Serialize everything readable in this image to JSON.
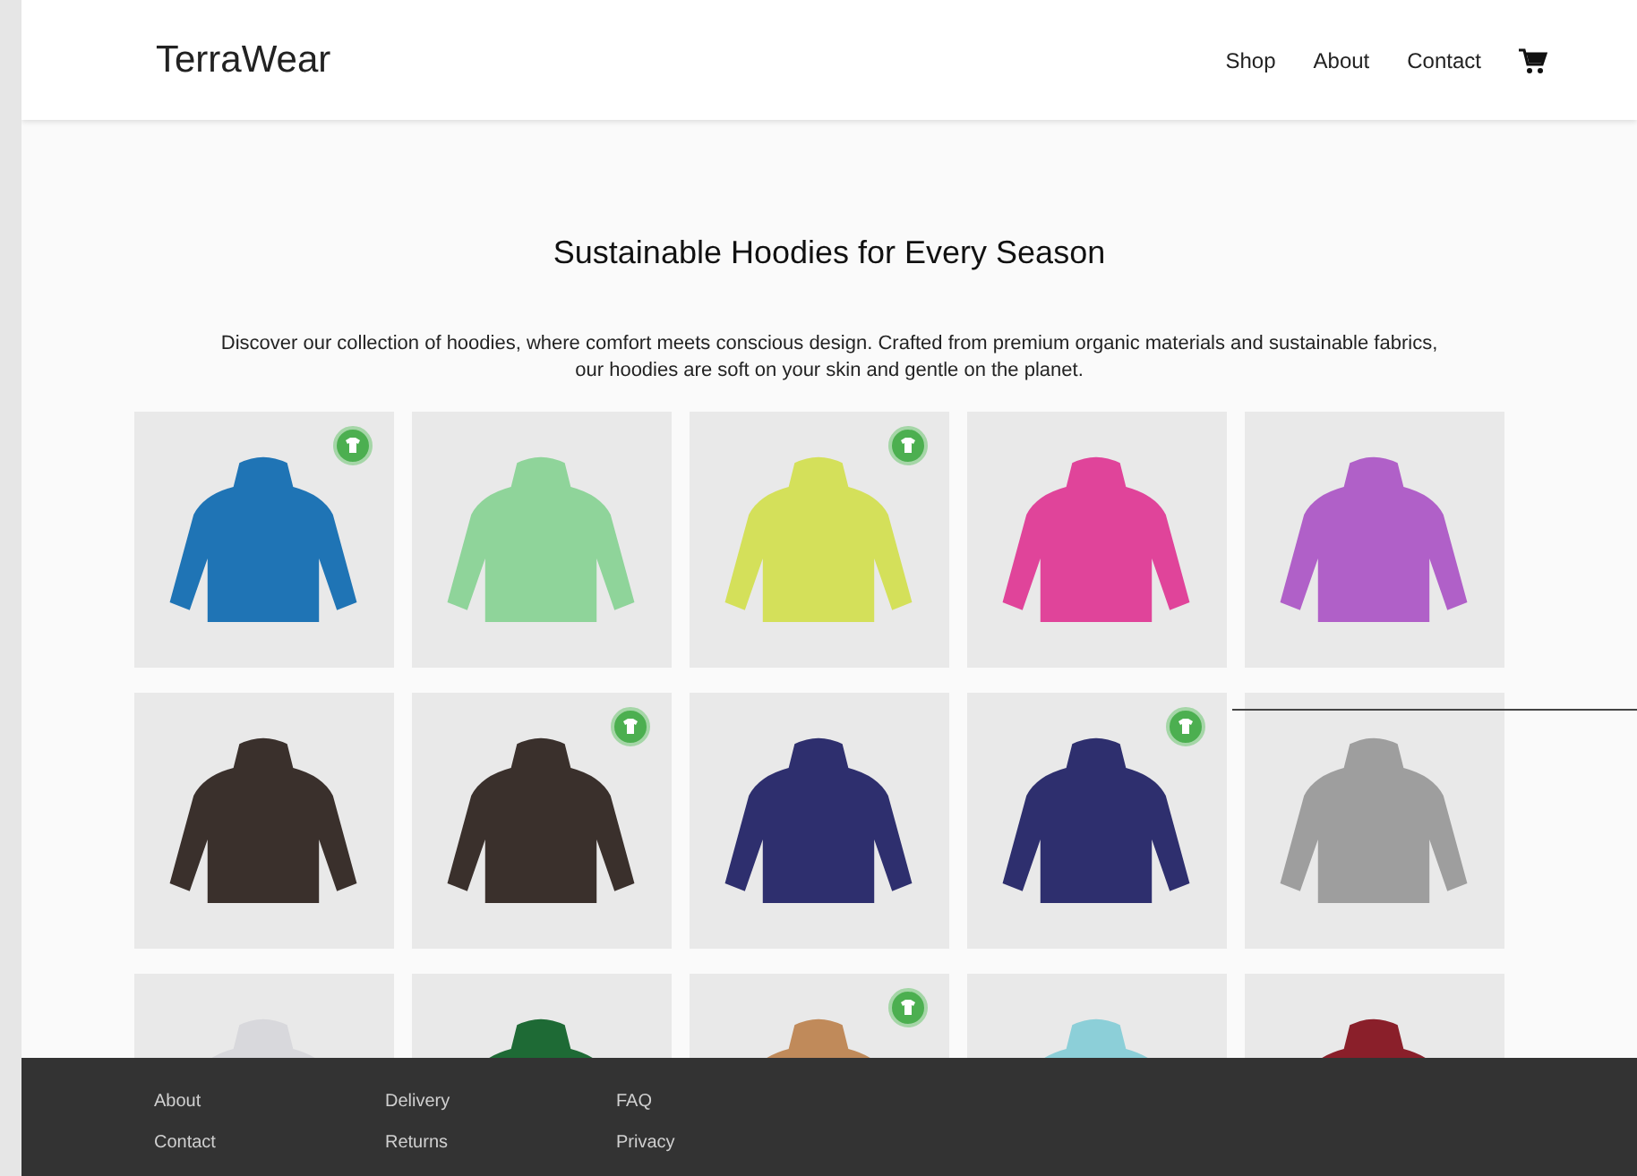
{
  "header": {
    "logo": "TerraWear",
    "nav": [
      "Shop",
      "About",
      "Contact"
    ]
  },
  "hero": {
    "title": "Sustainable Hoodies for Every Season",
    "description": "Discover our collection of hoodies, where comfort meets conscious design. Crafted from premium organic materials and sustainable fabrics, our hoodies are soft on your skin and gentle on the planet."
  },
  "products": [
    {
      "color": "#1f74b5",
      "eco_badge": true
    },
    {
      "color": "#8fd49a",
      "eco_badge": false
    },
    {
      "color": "#d4e05a",
      "eco_badge": true
    },
    {
      "color": "#e0449a",
      "eco_badge": false
    },
    {
      "color": "#b060c8",
      "eco_badge": false
    },
    {
      "color": "#3a302c",
      "eco_badge": false
    },
    {
      "color": "#3a302c",
      "eco_badge": true
    },
    {
      "color": "#2e2f6e",
      "eco_badge": false
    },
    {
      "color": "#2e2f6e",
      "eco_badge": true
    },
    {
      "color": "#9e9e9e",
      "eco_badge": false
    },
    {
      "color": "#d8d8dc",
      "eco_badge": false
    },
    {
      "color": "#1e6a35",
      "eco_badge": false
    },
    {
      "color": "#c08a5a",
      "eco_badge": true
    },
    {
      "color": "#8ccfd8",
      "eco_badge": false
    },
    {
      "color": "#8a1f2a",
      "eco_badge": false
    }
  ],
  "footer": {
    "columns": [
      [
        "About",
        "Contact"
      ],
      [
        "Delivery",
        "Returns"
      ],
      [
        "FAQ",
        "Privacy"
      ]
    ]
  }
}
